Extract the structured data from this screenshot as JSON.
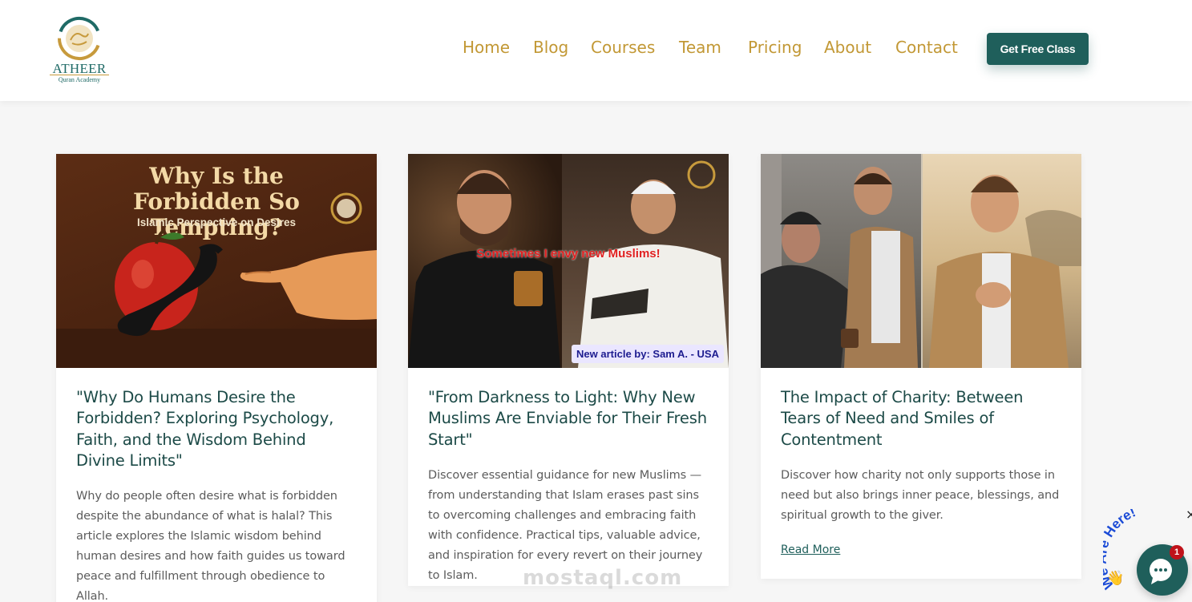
{
  "brand": {
    "name": "ATHEER",
    "tagline": "Quran Academy",
    "colors": {
      "primary": "#1f5f5b",
      "gold": "#c29835",
      "text_dark": "#1c4a47"
    }
  },
  "nav": {
    "items": [
      {
        "label": "Home"
      },
      {
        "label": "Blog"
      },
      {
        "label": "Courses"
      },
      {
        "label": "Team"
      },
      {
        "label": "Pricing"
      },
      {
        "label": "About"
      },
      {
        "label": "Contact"
      }
    ],
    "cta_label": "Get Free Class"
  },
  "posts": [
    {
      "image": {
        "title": "Why Is the Forbidden So Tempting?",
        "subtitle": "Islamic Perspective on Desires",
        "icon": "apple-snake-illustration"
      },
      "title": "\"Why Do Humans Desire the Forbidden? Exploring Psychology, Faith, and the Wisdom Behind Divine Limits\"",
      "excerpt": "Why do people often desire what is forbidden despite the abundance of what is halal? This article explores the Islamic wisdom behind human desires and how faith guides us toward peace and fulfillment through obedience to Allah."
    },
    {
      "image": {
        "caption": "Sometimes I envy new Muslims!",
        "badge": "New article by: Sam A. - USA",
        "icon": "two-men-photo"
      },
      "title": "\"From Darkness to Light: Why New Muslims Are Enviable for Their Fresh Start\"",
      "excerpt": "Discover essential guidance for new Muslims — from understanding that Islam erases past sins to overcoming challenges and embracing faith with confidence. Practical tips, valuable advice, and inspiration for every revert on their journey to Islam."
    },
    {
      "image": {
        "icon": "charity-photo"
      },
      "title": "The Impact of Charity: Between Tears of Need and Smiles of Contentment",
      "excerpt": "Discover how charity not only supports those in need but also brings inner peace, blessings, and spiritual growth to the giver.",
      "read_more": "Read More"
    }
  ],
  "watermark": "mostaql.com",
  "chat": {
    "label": "We Are Here!",
    "badge_count": "1",
    "close": "×",
    "icon": "chat-icon"
  }
}
